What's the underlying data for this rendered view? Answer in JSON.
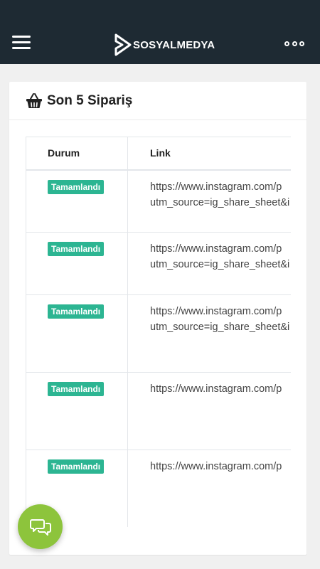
{
  "status_bar": {
    "text": ""
  },
  "header": {
    "logo_text": "SOSYALMEDYA",
    "menu_icon": "hamburger-icon",
    "more_icon": "more-dots-icon"
  },
  "card": {
    "icon": "basket-icon",
    "title": "Son 5 Sipariş",
    "columns": [
      "Durum",
      "Link"
    ],
    "rows": [
      {
        "status": "Tamamlandı",
        "link_lines": [
          "https://www.instagram.com/p",
          "utm_source=ig_share_sheet&i"
        ]
      },
      {
        "status": "Tamamlandı",
        "link_lines": [
          "https://www.instagram.com/p",
          "utm_source=ig_share_sheet&i"
        ]
      },
      {
        "status": "Tamamlandı",
        "link_lines": [
          "https://www.instagram.com/p",
          "utm_source=ig_share_sheet&i"
        ]
      },
      {
        "status": "Tamamlandı",
        "link_lines": [
          "https://www.instagram.com/p",
          ""
        ]
      },
      {
        "status": "Tamamlandı",
        "link_lines": [
          "https://www.instagram.com/p",
          ""
        ]
      }
    ]
  },
  "chat_button": {
    "icon": "chat-bubbles-icon"
  },
  "colors": {
    "topbar": "#1e2a33",
    "badge": "#2cb592",
    "chat_button": "#8dc43c",
    "background": "#f0f0f0"
  }
}
